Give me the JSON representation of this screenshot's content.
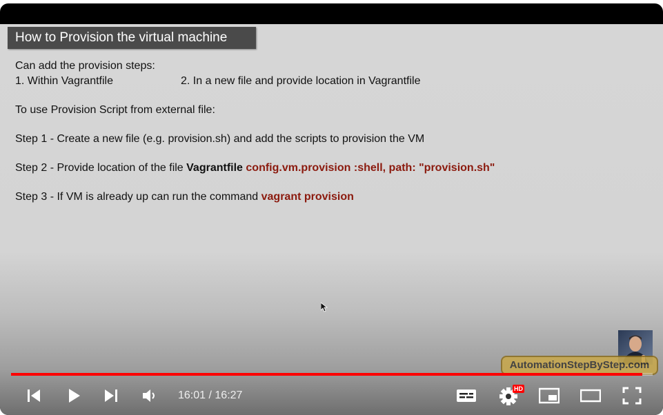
{
  "slide": {
    "title": "How to  Provision the virtual machine",
    "intro": "Can add the provision steps:",
    "option1": "1. Within Vagrantfile",
    "option2": "2. In a new file and provide location in Vagrantfile",
    "external_heading": "To use Provision Script from external file:",
    "step1": "Step 1 - Create a new file (e.g. provision.sh) and add the scripts to provision the VM",
    "step2_prefix": "Step 2 - Provide location of the file ",
    "step2_bold": "Vagrantfile",
    "step2_code": "config.vm.provision :shell, path: \"provision.sh\"",
    "step3_prefix": "Step 3 - If VM is already up can run the command ",
    "step3_code": "vagrant provision"
  },
  "overlay": {
    "watermark": "AutomationStepByStep.com"
  },
  "player": {
    "progress_fraction": 0.9839,
    "current_time": "16:01",
    "separator": " / ",
    "duration": "16:27",
    "hd_badge": "HD",
    "accent_color": "#ff0000",
    "code_color": "#8b1a0e",
    "icons": [
      "previous-icon",
      "play-icon",
      "next-icon",
      "volume-icon",
      "subtitles-icon",
      "settings-icon",
      "miniplayer-icon",
      "theater-icon",
      "fullscreen-icon"
    ]
  }
}
